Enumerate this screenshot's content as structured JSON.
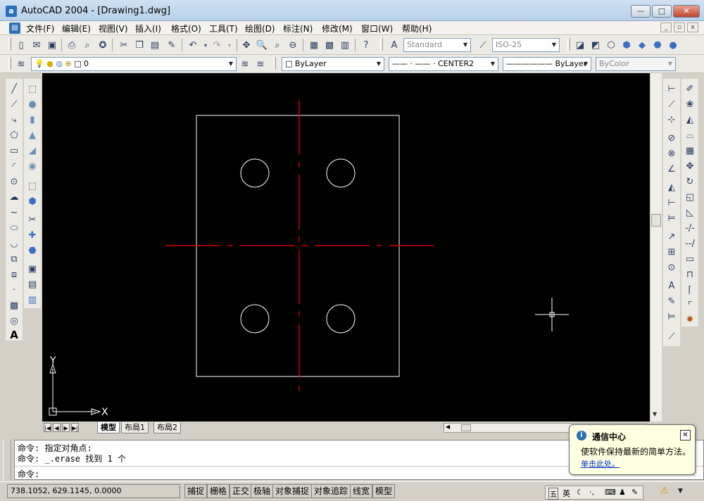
{
  "window": {
    "app_icon": "autocad-logo-icon",
    "app_icon_letter": "a",
    "title": "AutoCAD 2004 - [Drawing1.dwg]",
    "min_glyph": "—",
    "max_glyph": "□",
    "close_glyph": "✕"
  },
  "menubar": {
    "items": [
      "文件(F)",
      "编辑(E)",
      "视图(V)",
      "插入(I)",
      "格式(O)",
      "工具(T)",
      "绘图(D)",
      "标注(N)",
      "修改(M)",
      "窗口(W)",
      "帮助(H)"
    ],
    "mdi_min": "_",
    "mdi_restore": "▫",
    "mdi_close": "x"
  },
  "standard_toolbar": {
    "text_style": "Standard",
    "dim_style": "ISO-25"
  },
  "properties_toolbar": {
    "layer": "0",
    "color": "ByLayer",
    "linetype": "CENTER2",
    "linetype_preview": "—— · —— ·",
    "lineweight": "ByLayer",
    "plot_style": "ByColor"
  },
  "drawing": {
    "ucs_x_label": "X",
    "ucs_y_label": "Y",
    "line_color": "#ffffff",
    "centerline_color": "#cc0000"
  },
  "layout_tabs": {
    "model": "模型",
    "layout1": "布局1",
    "layout2": "布局2"
  },
  "command": {
    "line1": "命令: 指定对角点:",
    "line2": "命令: _.erase 找到 1 个",
    "prompt": "命令:"
  },
  "status": {
    "coordinates": "738.1052, 629.1145, 0.0000",
    "snap": "捕捉",
    "grid": "栅格",
    "ortho": "正交",
    "polar": "极轴",
    "osnap": "对象捕捉",
    "otrack": "对象追踪",
    "lwt": "线宽",
    "model": "模型"
  },
  "balloon": {
    "title": "通信中心",
    "body": "使软件保持最新的简单方法。",
    "link": "单击此处。",
    "close": "✕"
  },
  "ime": {
    "lang": "英",
    "mode": "五"
  }
}
